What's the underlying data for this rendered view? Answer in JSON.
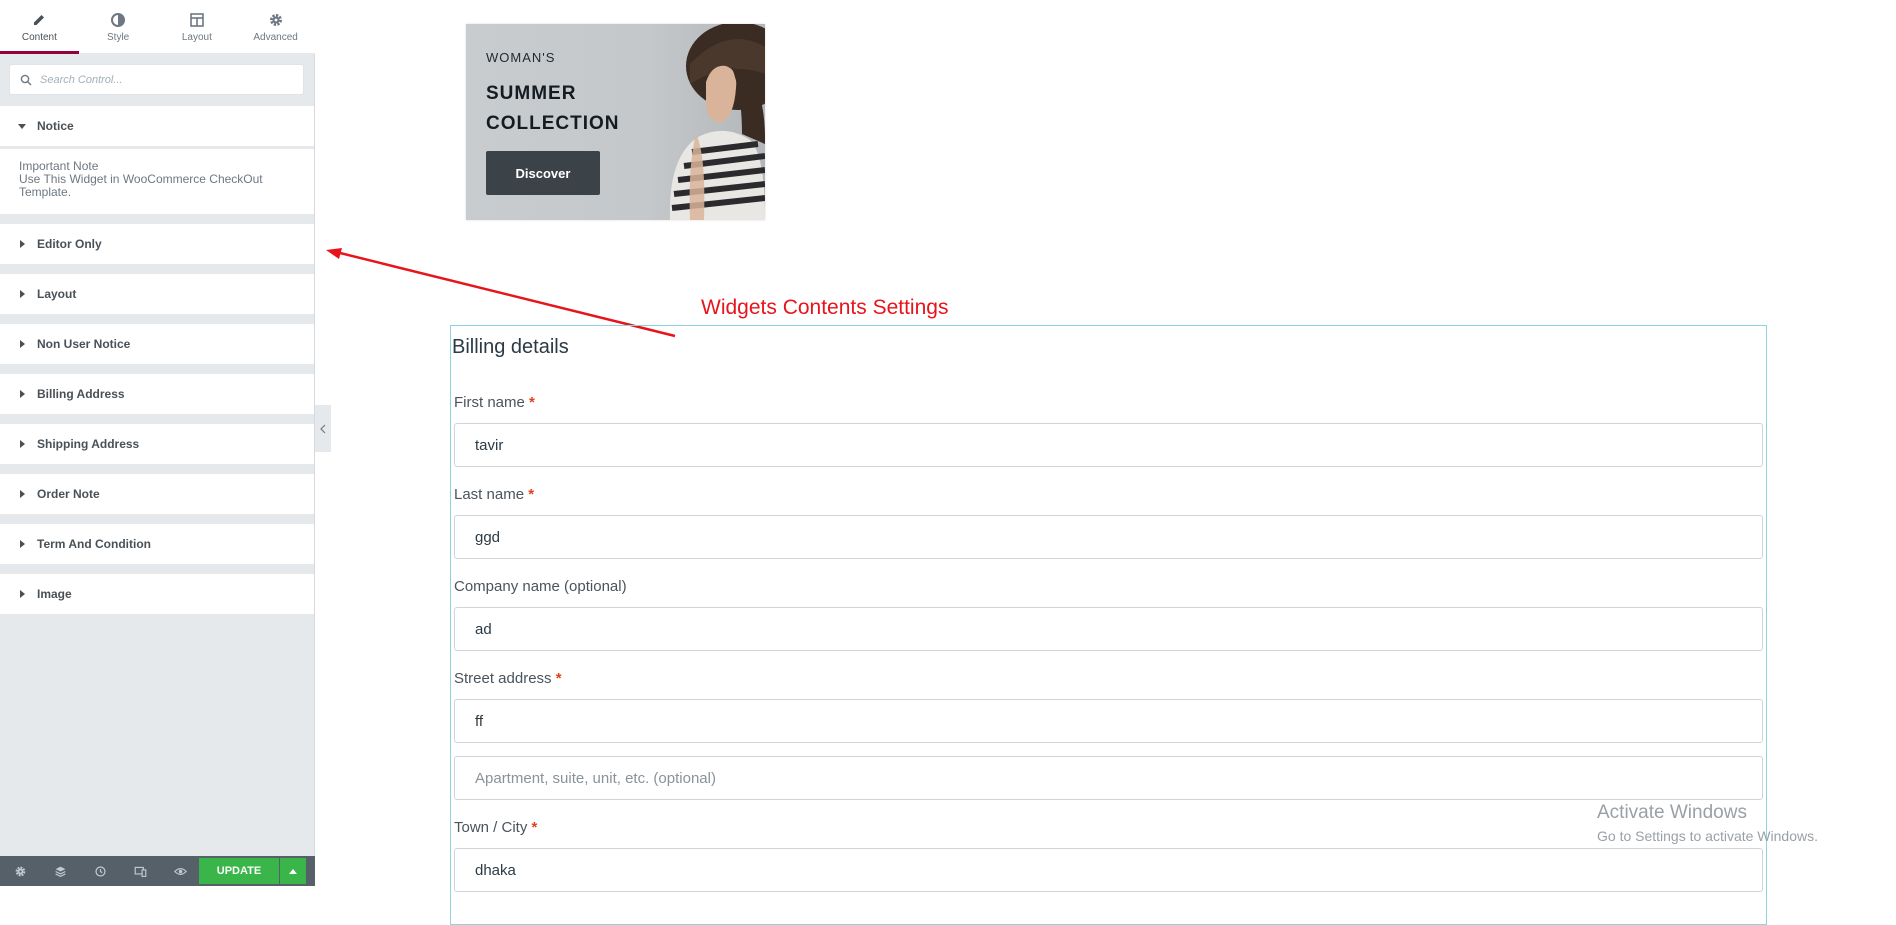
{
  "panel": {
    "tabs": [
      {
        "label": "Content",
        "icon": "pencil-icon"
      },
      {
        "label": "Style",
        "icon": "half-circle-icon"
      },
      {
        "label": "Layout",
        "icon": "layout-icon"
      },
      {
        "label": "Advanced",
        "icon": "gear-icon"
      }
    ],
    "search_placeholder": "Search Control...",
    "notice": {
      "title": "Notice",
      "line1": "Important Note",
      "line2": "Use This Widget in WooCommerce CheckOut Template."
    },
    "sections": [
      "Editor Only",
      "Layout",
      "Non User Notice",
      "Billing Address",
      "Shipping Address",
      "Order Note",
      "Term And Condition",
      "Image"
    ],
    "footer": {
      "icons": [
        "settings-icon",
        "layers-icon",
        "history-icon",
        "responsive-icon",
        "preview-eye-icon"
      ],
      "update_label": "UPDATE"
    }
  },
  "banner": {
    "small": "WOMAN'S",
    "title": "SUMMER COLLECTION",
    "button": "Discover"
  },
  "annotation": {
    "label": "Widgets Contents Settings",
    "color": "#e8141b"
  },
  "billing": {
    "heading": "Billing details",
    "fields": [
      {
        "label": "First name",
        "required": "*",
        "value": "tavir"
      },
      {
        "label": "Last name",
        "required": "*",
        "value": "ggd"
      },
      {
        "label": "Company name (optional)",
        "required": "",
        "value": "ad"
      },
      {
        "label": "Street address",
        "required": "*",
        "value": "ff"
      },
      {
        "label": "",
        "required": "",
        "value": "",
        "placeholder": "Apartment, suite, unit, etc. (optional)"
      },
      {
        "label": "Town / City",
        "required": "*",
        "value": "dhaka"
      }
    ]
  },
  "watermark": {
    "line1": "Activate Windows",
    "line2": "Go to Settings to activate Windows."
  },
  "colors": {
    "accent_tab": "#93003c",
    "update_green": "#39b54a",
    "panel_bg": "#e6e9ec",
    "footer_bg": "#556068"
  }
}
